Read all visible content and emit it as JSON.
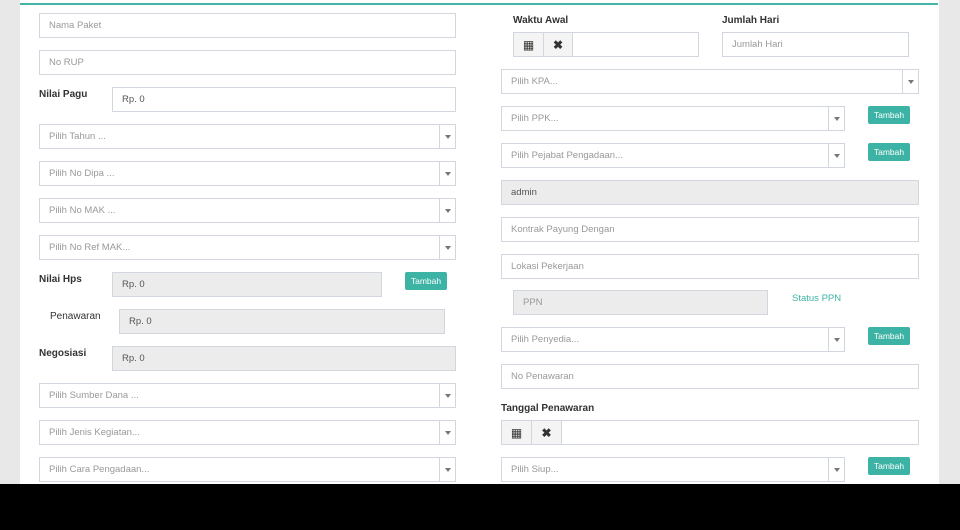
{
  "left": {
    "nama_paket": {
      "placeholder": "Nama Paket"
    },
    "no_rup": {
      "placeholder": "No RUP"
    },
    "nilai_pagu": {
      "label": "Nilai Pagu",
      "value": "Rp. 0"
    },
    "tahun": {
      "placeholder": "Pilih Tahun ..."
    },
    "no_dipa": {
      "placeholder": "Pilih No Dipa ..."
    },
    "no_mak": {
      "placeholder": "Pilih No MAK ..."
    },
    "no_ref_mak": {
      "placeholder": "Pilih No Ref MAK..."
    },
    "nilai_hps": {
      "label": "Nilai Hps",
      "value": "Rp. 0",
      "button": "Tambah"
    },
    "penawaran": {
      "label": "Penawaran",
      "value": "Rp. 0"
    },
    "negosiasi": {
      "label": "Negosiasi",
      "value": "Rp. 0"
    },
    "sumber_dana": {
      "placeholder": "Pilih Sumber Dana ..."
    },
    "jenis_kegiatan": {
      "placeholder": "Pilih Jenis Kegiatan..."
    },
    "cara_pengadaan": {
      "placeholder": "Pilih Cara Pengadaan..."
    }
  },
  "right": {
    "waktu_awal": {
      "label": "Waktu Awal",
      "value": ""
    },
    "jumlah_hari": {
      "label": "Jumlah Hari",
      "placeholder": "Jumlah Hari"
    },
    "kpa": {
      "placeholder": "Pilih KPA..."
    },
    "ppk": {
      "placeholder": "Pilih PPK...",
      "button": "Tambah"
    },
    "pejabat": {
      "placeholder": "Pilih Pejabat Pengadaan...",
      "button": "Tambah"
    },
    "user": {
      "value": "admin"
    },
    "kontrak_payung": {
      "placeholder": "Kontrak Payung Dengan"
    },
    "lokasi": {
      "placeholder": "Lokasi Pekerjaan"
    },
    "ppn": {
      "placeholder": "PPN",
      "status_label": "Status PPN"
    },
    "penyedia": {
      "placeholder": "Pilih Penyedia...",
      "button": "Tambah"
    },
    "no_penawaran": {
      "placeholder": "No Penawaran"
    },
    "tanggal_penawaran": {
      "label": "Tanggal Penawaran",
      "value": ""
    },
    "siup": {
      "placeholder": "Pilih Siup...",
      "button": "Tambah"
    }
  }
}
